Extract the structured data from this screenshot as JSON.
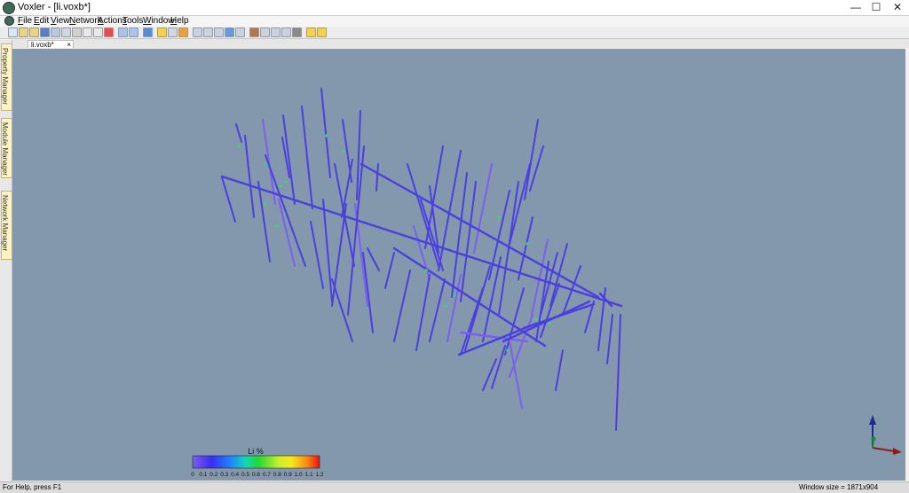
{
  "window": {
    "title": "Voxler - [li.voxb*]",
    "minimize_glyph": "—",
    "maximize_glyph": "☐",
    "close_glyph": "✕"
  },
  "menu": [
    {
      "label": "File",
      "hotkey": "F"
    },
    {
      "label": "Edit",
      "hotkey": "E"
    },
    {
      "label": "View",
      "hotkey": "V"
    },
    {
      "label": "Network",
      "hotkey": "N"
    },
    {
      "label": "Actions",
      "hotkey": "A"
    },
    {
      "label": "Tools",
      "hotkey": "T"
    },
    {
      "label": "Window",
      "hotkey": "W"
    },
    {
      "label": "Help",
      "hotkey": "H"
    }
  ],
  "sidebar": {
    "tabs": [
      "Property Manager",
      "Module Manager",
      "Network Manager"
    ]
  },
  "document_tab": {
    "label": "li.voxb*",
    "close_glyph": "×"
  },
  "colorbar": {
    "title": "Li %",
    "tick_labels": [
      "0",
      "0.1",
      "0.2",
      "0.3",
      "0.4",
      "0.5",
      "0.6",
      "0.7",
      "0.8",
      "0.9",
      "1.0",
      "1.1",
      "1.2"
    ]
  },
  "colors": {
    "viewport_bg": "#8397ad",
    "drillhole_low": "#4b3fe0",
    "drillhole_mid": "#7a5ff0",
    "highlight_green": "#3fd07a"
  },
  "status": {
    "left": "For Help, press F1",
    "right": "Window size = 1871x904"
  }
}
